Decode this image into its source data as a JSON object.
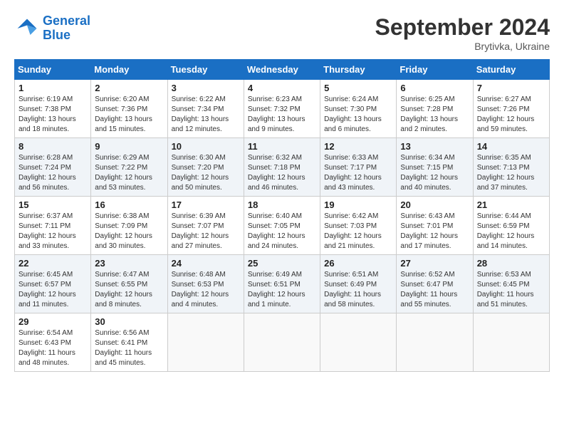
{
  "header": {
    "logo_line1": "General",
    "logo_line2": "Blue",
    "month_title": "September 2024",
    "location": "Brytivka, Ukraine"
  },
  "days_of_week": [
    "Sunday",
    "Monday",
    "Tuesday",
    "Wednesday",
    "Thursday",
    "Friday",
    "Saturday"
  ],
  "weeks": [
    [
      {
        "day": "1",
        "info": "Sunrise: 6:19 AM\nSunset: 7:38 PM\nDaylight: 13 hours\nand 18 minutes."
      },
      {
        "day": "2",
        "info": "Sunrise: 6:20 AM\nSunset: 7:36 PM\nDaylight: 13 hours\nand 15 minutes."
      },
      {
        "day": "3",
        "info": "Sunrise: 6:22 AM\nSunset: 7:34 PM\nDaylight: 13 hours\nand 12 minutes."
      },
      {
        "day": "4",
        "info": "Sunrise: 6:23 AM\nSunset: 7:32 PM\nDaylight: 13 hours\nand 9 minutes."
      },
      {
        "day": "5",
        "info": "Sunrise: 6:24 AM\nSunset: 7:30 PM\nDaylight: 13 hours\nand 6 minutes."
      },
      {
        "day": "6",
        "info": "Sunrise: 6:25 AM\nSunset: 7:28 PM\nDaylight: 13 hours\nand 2 minutes."
      },
      {
        "day": "7",
        "info": "Sunrise: 6:27 AM\nSunset: 7:26 PM\nDaylight: 12 hours\nand 59 minutes."
      }
    ],
    [
      {
        "day": "8",
        "info": "Sunrise: 6:28 AM\nSunset: 7:24 PM\nDaylight: 12 hours\nand 56 minutes."
      },
      {
        "day": "9",
        "info": "Sunrise: 6:29 AM\nSunset: 7:22 PM\nDaylight: 12 hours\nand 53 minutes."
      },
      {
        "day": "10",
        "info": "Sunrise: 6:30 AM\nSunset: 7:20 PM\nDaylight: 12 hours\nand 50 minutes."
      },
      {
        "day": "11",
        "info": "Sunrise: 6:32 AM\nSunset: 7:18 PM\nDaylight: 12 hours\nand 46 minutes."
      },
      {
        "day": "12",
        "info": "Sunrise: 6:33 AM\nSunset: 7:17 PM\nDaylight: 12 hours\nand 43 minutes."
      },
      {
        "day": "13",
        "info": "Sunrise: 6:34 AM\nSunset: 7:15 PM\nDaylight: 12 hours\nand 40 minutes."
      },
      {
        "day": "14",
        "info": "Sunrise: 6:35 AM\nSunset: 7:13 PM\nDaylight: 12 hours\nand 37 minutes."
      }
    ],
    [
      {
        "day": "15",
        "info": "Sunrise: 6:37 AM\nSunset: 7:11 PM\nDaylight: 12 hours\nand 33 minutes."
      },
      {
        "day": "16",
        "info": "Sunrise: 6:38 AM\nSunset: 7:09 PM\nDaylight: 12 hours\nand 30 minutes."
      },
      {
        "day": "17",
        "info": "Sunrise: 6:39 AM\nSunset: 7:07 PM\nDaylight: 12 hours\nand 27 minutes."
      },
      {
        "day": "18",
        "info": "Sunrise: 6:40 AM\nSunset: 7:05 PM\nDaylight: 12 hours\nand 24 minutes."
      },
      {
        "day": "19",
        "info": "Sunrise: 6:42 AM\nSunset: 7:03 PM\nDaylight: 12 hours\nand 21 minutes."
      },
      {
        "day": "20",
        "info": "Sunrise: 6:43 AM\nSunset: 7:01 PM\nDaylight: 12 hours\nand 17 minutes."
      },
      {
        "day": "21",
        "info": "Sunrise: 6:44 AM\nSunset: 6:59 PM\nDaylight: 12 hours\nand 14 minutes."
      }
    ],
    [
      {
        "day": "22",
        "info": "Sunrise: 6:45 AM\nSunset: 6:57 PM\nDaylight: 12 hours\nand 11 minutes."
      },
      {
        "day": "23",
        "info": "Sunrise: 6:47 AM\nSunset: 6:55 PM\nDaylight: 12 hours\nand 8 minutes."
      },
      {
        "day": "24",
        "info": "Sunrise: 6:48 AM\nSunset: 6:53 PM\nDaylight: 12 hours\nand 4 minutes."
      },
      {
        "day": "25",
        "info": "Sunrise: 6:49 AM\nSunset: 6:51 PM\nDaylight: 12 hours\nand 1 minute."
      },
      {
        "day": "26",
        "info": "Sunrise: 6:51 AM\nSunset: 6:49 PM\nDaylight: 11 hours\nand 58 minutes."
      },
      {
        "day": "27",
        "info": "Sunrise: 6:52 AM\nSunset: 6:47 PM\nDaylight: 11 hours\nand 55 minutes."
      },
      {
        "day": "28",
        "info": "Sunrise: 6:53 AM\nSunset: 6:45 PM\nDaylight: 11 hours\nand 51 minutes."
      }
    ],
    [
      {
        "day": "29",
        "info": "Sunrise: 6:54 AM\nSunset: 6:43 PM\nDaylight: 11 hours\nand 48 minutes."
      },
      {
        "day": "30",
        "info": "Sunrise: 6:56 AM\nSunset: 6:41 PM\nDaylight: 11 hours\nand 45 minutes."
      },
      {
        "day": "",
        "info": ""
      },
      {
        "day": "",
        "info": ""
      },
      {
        "day": "",
        "info": ""
      },
      {
        "day": "",
        "info": ""
      },
      {
        "day": "",
        "info": ""
      }
    ]
  ]
}
